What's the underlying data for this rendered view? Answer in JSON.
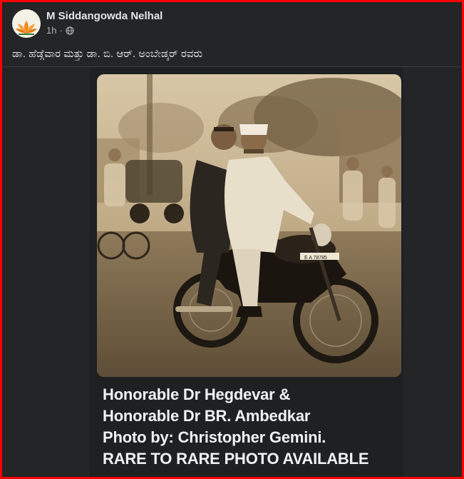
{
  "post": {
    "author": "M Siddangowda Nelhal",
    "time": "1h",
    "privacy_icon": "globe-icon",
    "text": "ಡಾ. ಹೆಡ್ಗೆವಾರ ಮತ್ತು ಡಾ. ಬಿ. ಆರ್. ಅಂಬೇಡ್ಕರ್ ರವರು"
  },
  "image_caption": {
    "line1": "Honorable Dr Hegdevar &",
    "line2": "Honorable Dr BR. Ambedkar",
    "line3": "Photo by: Christopher Gemini.",
    "line4": "RARE TO RARE PHOTO AVAILABLE"
  },
  "photo": {
    "plate": "E A 78785"
  },
  "colors": {
    "background": "#242526",
    "border": "#ff0000",
    "text_primary": "#e4e6eb",
    "text_secondary": "#b0b3b8",
    "sepia": "#b49a72"
  }
}
